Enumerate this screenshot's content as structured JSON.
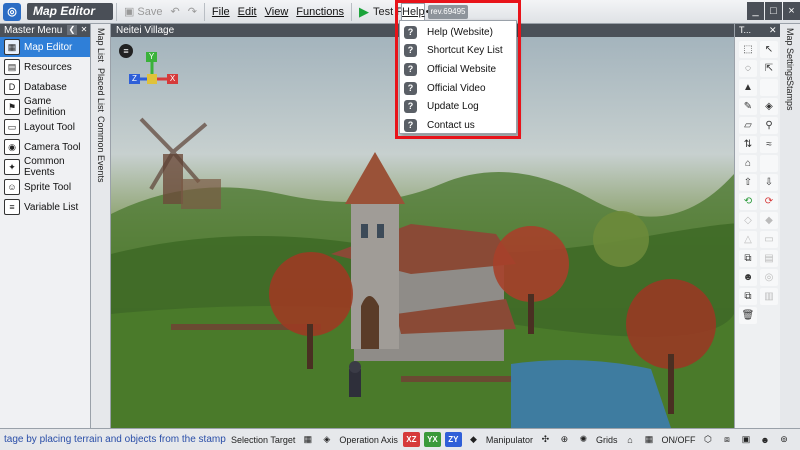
{
  "window": {
    "title": "Map Editor",
    "controls": [
      "_",
      "□",
      "×"
    ]
  },
  "toolbar": {
    "save_label": "Save",
    "menus": [
      "File",
      "Edit",
      "View",
      "Functions"
    ],
    "test_play_label": "Test Play",
    "more_label": "•••",
    "help_label": "Help",
    "revision": "rev.69495"
  },
  "help_menu": {
    "items": [
      "Help (Website)",
      "Shortcut Key List",
      "Official Website",
      "Official Video",
      "Update Log",
      "Contact us"
    ]
  },
  "master_menu": {
    "title": "Master Menu",
    "items": [
      {
        "label": "Map Editor",
        "icon": "map-icon",
        "active": true
      },
      {
        "label": "Resources",
        "icon": "resources-icon",
        "active": false
      },
      {
        "label": "Database",
        "icon": "database-icon",
        "active": false
      },
      {
        "label": "Game Definition",
        "icon": "game-definition-icon",
        "active": false
      },
      {
        "label": "Layout Tool",
        "icon": "layout-icon",
        "active": false
      },
      {
        "label": "Camera Tool",
        "icon": "camera-icon",
        "active": false
      },
      {
        "label": "Common Events",
        "icon": "events-icon",
        "active": false
      },
      {
        "label": "Sprite Tool",
        "icon": "sprite-icon",
        "active": false
      },
      {
        "label": "Variable List",
        "icon": "variable-icon",
        "active": false
      }
    ]
  },
  "side_tabs": [
    "Map List",
    "Placed List",
    "Common Events"
  ],
  "viewport": {
    "map_name": "Neitei Village",
    "gizmo": {
      "y": "Y",
      "z": "Z",
      "x": "X"
    }
  },
  "tool_panel": {
    "title": "T..."
  },
  "right_tabs": [
    "Map Settings",
    "Stamps"
  ],
  "status_bar": {
    "hint": "tage by placing terrain and objects from the stamp pale",
    "selection_target": "Selection Target",
    "operation_axis": "Operation Axis",
    "axes": [
      "XZ",
      "YX",
      "ZY"
    ],
    "manipulator": "Manipulator",
    "grids": "Grids",
    "on_off": "ON/OFF"
  },
  "colors": {
    "accent": "#2f7fd8",
    "highlight": "#e8131a",
    "axis_xz": "#d63a3a",
    "axis_yx": "#3a9a3a",
    "axis_zy": "#2f5fd8"
  }
}
